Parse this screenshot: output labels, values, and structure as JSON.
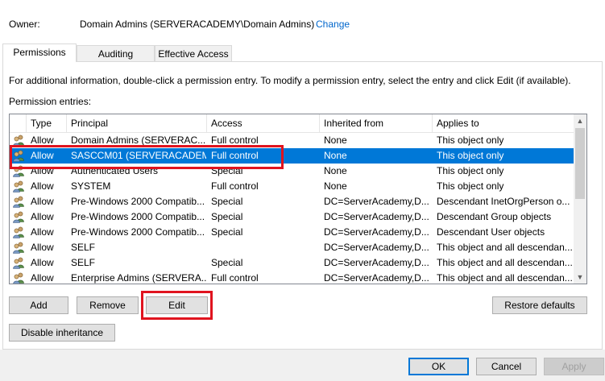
{
  "owner": {
    "label": "Owner:",
    "value": "Domain Admins (SERVERACADEMY\\Domain Admins)",
    "change_link": "Change"
  },
  "tabs": [
    {
      "label": "Permissions",
      "active": true
    },
    {
      "label": "Auditing",
      "active": false
    },
    {
      "label": "Effective Access",
      "active": false
    }
  ],
  "info_text": "For additional information, double-click a permission entry. To modify a permission entry, select the entry and click Edit (if available).",
  "entries_label": "Permission entries:",
  "table": {
    "columns": [
      "Type",
      "Principal",
      "Access",
      "Inherited from",
      "Applies to"
    ],
    "rows": [
      {
        "type": "Allow",
        "principal": "Domain Admins (SERVERAC...",
        "access": "Full control",
        "inherited": "None",
        "applies": "This object only",
        "selected": false
      },
      {
        "type": "Allow",
        "principal": "SASCCM01 (SERVERACADEM...",
        "access": "Full control",
        "inherited": "None",
        "applies": "This object only",
        "selected": true
      },
      {
        "type": "Allow",
        "principal": "Authenticated Users",
        "access": "Special",
        "inherited": "None",
        "applies": "This object only",
        "selected": false
      },
      {
        "type": "Allow",
        "principal": "SYSTEM",
        "access": "Full control",
        "inherited": "None",
        "applies": "This object only",
        "selected": false
      },
      {
        "type": "Allow",
        "principal": "Pre-Windows 2000 Compatib...",
        "access": "Special",
        "inherited": "DC=ServerAcademy,D...",
        "applies": "Descendant InetOrgPerson o...",
        "selected": false
      },
      {
        "type": "Allow",
        "principal": "Pre-Windows 2000 Compatib...",
        "access": "Special",
        "inherited": "DC=ServerAcademy,D...",
        "applies": "Descendant Group objects",
        "selected": false
      },
      {
        "type": "Allow",
        "principal": "Pre-Windows 2000 Compatib...",
        "access": "Special",
        "inherited": "DC=ServerAcademy,D...",
        "applies": "Descendant User objects",
        "selected": false
      },
      {
        "type": "Allow",
        "principal": "SELF",
        "access": "",
        "inherited": "DC=ServerAcademy,D...",
        "applies": "This object and all descendan...",
        "selected": false
      },
      {
        "type": "Allow",
        "principal": "SELF",
        "access": "Special",
        "inherited": "DC=ServerAcademy,D...",
        "applies": "This object and all descendan...",
        "selected": false
      },
      {
        "type": "Allow",
        "principal": "Enterprise Admins (SERVERA...",
        "access": "Full control",
        "inherited": "DC=ServerAcademy,D...",
        "applies": "This object and all descendan...",
        "selected": false
      }
    ]
  },
  "buttons": {
    "add": "Add",
    "remove": "Remove",
    "edit": "Edit",
    "restore_defaults": "Restore defaults",
    "disable_inheritance": "Disable inheritance",
    "ok": "OK",
    "cancel": "Cancel",
    "apply": "Apply"
  },
  "icons": {
    "principal": "user-group-icon",
    "scroll_up": "scroll-up-arrow-icon",
    "scroll_down": "scroll-down-arrow-icon"
  },
  "colors": {
    "selection": "#0078d7",
    "link": "#0066cc",
    "highlight": "#e0141f"
  }
}
